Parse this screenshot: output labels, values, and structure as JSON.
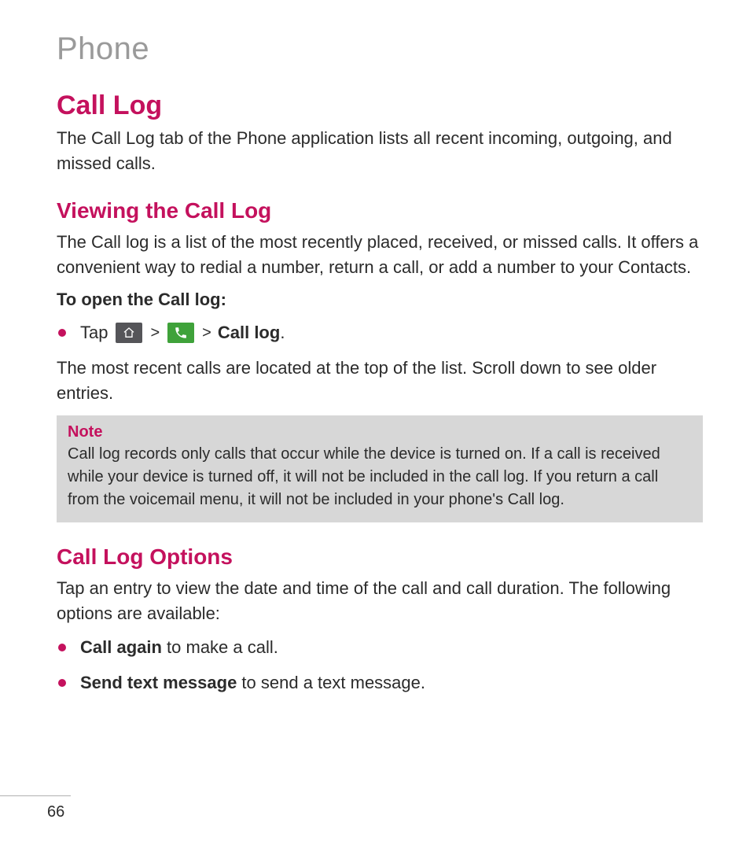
{
  "chapter": "Phone",
  "section": {
    "title": "Call Log",
    "intro": "The Call Log tab of the Phone application lists all recent incoming, outgoing, and missed calls."
  },
  "viewing": {
    "title": "Viewing the Call Log",
    "desc": "The Call log is a list of the most recently placed, received, or missed calls. It offers a convenient way to redial a number, return a call, or add a number to your Contacts.",
    "open_label": "To open the Call log:",
    "tap_prefix": "Tap",
    "sep": ">",
    "call_log_bold": "Call log",
    "period": ".",
    "after": "The most recent calls are located at the top of the list. Scroll down to see older entries."
  },
  "note": {
    "title": "Note",
    "text": "Call log records only calls that occur while the device is turned on. If a call is received while your device is turned off, it will not be included in the call log. If you return a call from the voicemail menu, it will not be included in your phone's Call log."
  },
  "options": {
    "title": "Call Log Options",
    "intro": "Tap an entry to view the date and time of the call and call duration. The following options are available:",
    "items": [
      {
        "bold": "Call again",
        "rest": " to make a call."
      },
      {
        "bold": "Send text message",
        "rest": " to send a text message."
      }
    ]
  },
  "page_number": "66"
}
